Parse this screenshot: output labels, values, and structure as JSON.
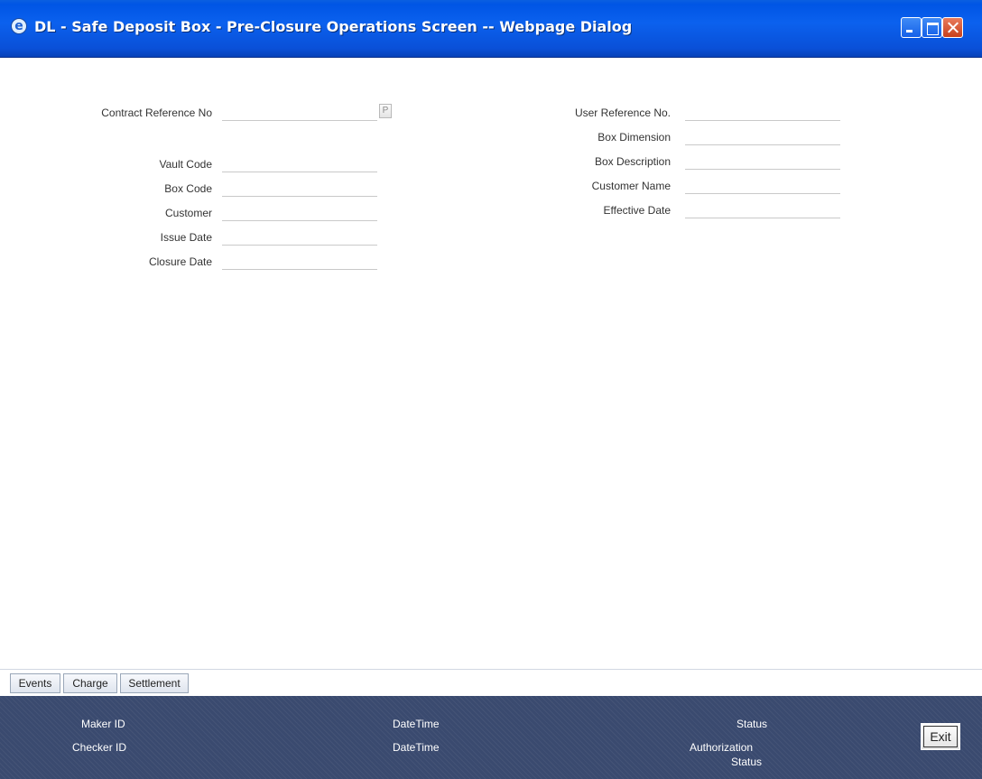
{
  "window": {
    "title": "DL - Safe Deposit Box - Pre-Closure Operations Screen -- Webpage Dialog",
    "icon": "ie-icon"
  },
  "form": {
    "contract_ref_label": "Contract Reference No",
    "contract_ref_value": "",
    "lov_glyph": "P",
    "vault_code_label": "Vault Code",
    "vault_code_value": "",
    "box_code_label": "Box Code",
    "box_code_value": "",
    "customer_label": "Customer",
    "customer_value": "",
    "issue_date_label": "Issue Date",
    "issue_date_value": "",
    "closure_date_label": "Closure Date",
    "closure_date_value": "",
    "user_ref_label": "User Reference No.",
    "user_ref_value": "",
    "box_dimension_label": "Box Dimension",
    "box_dimension_value": "",
    "box_description_label": "Box Description",
    "box_description_value": "",
    "customer_name_label": "Customer Name",
    "customer_name_value": "",
    "effective_date_label": "Effective Date",
    "effective_date_value": ""
  },
  "tabs": [
    {
      "label": "Events"
    },
    {
      "label": "Charge"
    },
    {
      "label": "Settlement"
    }
  ],
  "footer": {
    "maker_id_label": "Maker ID",
    "checker_id_label": "Checker ID",
    "datetime_label_1": "DateTime",
    "datetime_label_2": "DateTime",
    "status_label": "Status",
    "auth_status_line1": "Authorization",
    "auth_status_line2": "Status",
    "exit_label": "Exit"
  },
  "colors": {
    "titlebar": "#0a5fe0",
    "footer": "#3a4a6f"
  }
}
